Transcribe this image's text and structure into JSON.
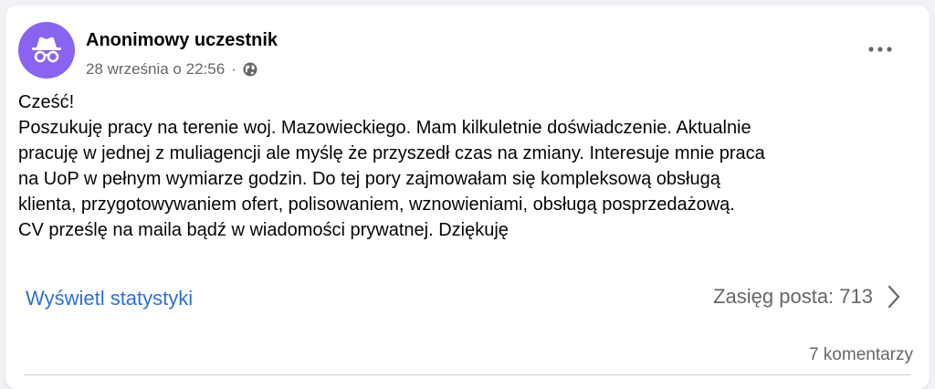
{
  "post": {
    "author": "Anonimowy uczestnik",
    "timestamp": "28 września o 22:56",
    "separator": "·",
    "audience_icon": "globe-icon",
    "avatar_icon": "incognito-icon",
    "more_icon": "more-options-icon",
    "lines": [
      "Cześć!",
      "Poszukuję pracy na terenie woj. Mazowieckiego. Mam kilkuletnie doświadczenie. Aktualnie",
      "pracuję w jednej z muliagencji ale myślę że przyszedł czas na zmiany.  Interesuje mnie praca",
      "na UoP w pełnym wymiarze godzin. Do tej pory zajmowałam się kompleksową obsługą",
      "klienta, przygotowywaniem ofert, polisowaniem, wznowieniami, obsługą posprzedażową.",
      "CV prześlę na maila bądź w wiadomości prywatnej. Dziękuję"
    ]
  },
  "footer": {
    "stats_link": "Wyświetl statystyki",
    "reach": "Zasięg posta: 713",
    "comments": "7 komentarzy"
  },
  "colors": {
    "avatar_bg": "#8a64f0",
    "link": "#2e6fd6",
    "secondary_text": "#65676b"
  }
}
